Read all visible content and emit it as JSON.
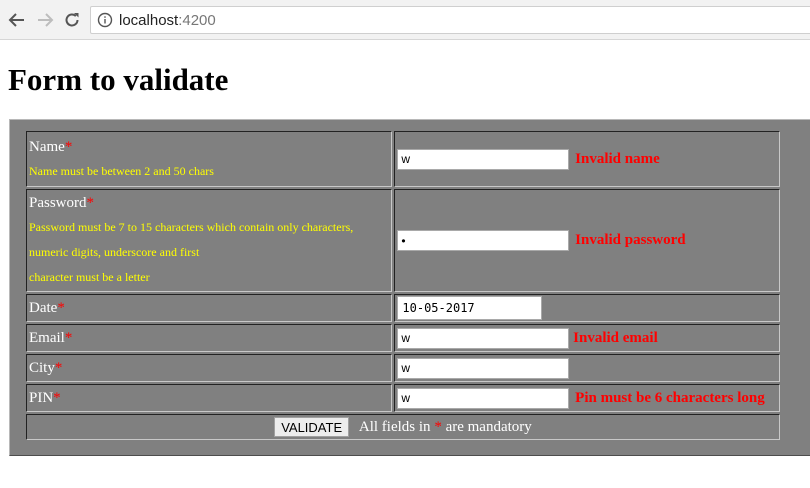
{
  "browser": {
    "url_host": "localhost",
    "url_port": ":4200"
  },
  "page": {
    "title": "Form to validate"
  },
  "form": {
    "required_marker": "*",
    "fields": {
      "name": {
        "label": "Name",
        "hint": "Name must be between 2 and 50 chars",
        "value": "w",
        "error": "Invalid name"
      },
      "password": {
        "label": "Password",
        "hint_lines": [
          "Password must be 7 to 15 characters which contain only characters,",
          "numeric digits, underscore and first",
          "character must be a letter"
        ],
        "value": "w",
        "error": "Invalid password"
      },
      "date": {
        "label": "Date",
        "value": "10-05-2017"
      },
      "email": {
        "label": "Email",
        "value": "w",
        "error": "Invalid email"
      },
      "city": {
        "label": "City",
        "value": "w"
      },
      "pin": {
        "label": "PIN",
        "value": "w",
        "error": "Pin must be 6 characters long"
      }
    },
    "validate_label": "VALIDATE",
    "mandatory_note_prefix": "All fields in",
    "mandatory_note_suffix": "are mandatory"
  },
  "colors": {
    "form_background": "#808080",
    "label_text": "#ffffff",
    "hint_text": "#ffff00",
    "error_text": "#ff0000"
  },
  "icons": {
    "back": "arrow-left-icon",
    "forward": "arrow-right-icon",
    "reload": "reload-icon",
    "site_info": "info-circle-icon"
  }
}
